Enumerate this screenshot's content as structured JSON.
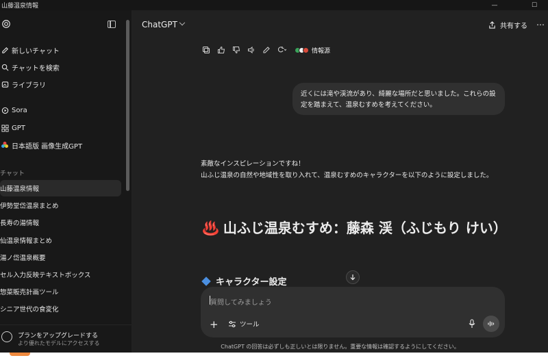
{
  "window": {
    "title": "山藤温泉情報"
  },
  "sidebar": {
    "nav": [
      {
        "label": "新しいチャット",
        "icon": "new-chat-icon"
      },
      {
        "label": "チャットを検索",
        "icon": "search-icon"
      },
      {
        "label": "ライブラリ",
        "icon": "library-icon"
      },
      {
        "label": "Sora",
        "icon": "sora-icon"
      },
      {
        "label": "GPT",
        "icon": "gpt-icon"
      },
      {
        "label": "日本語版 画像生成GPT",
        "icon": "colorful-gpt-icon"
      }
    ],
    "section_label": "チャット",
    "chats": [
      "山藤温泉情報",
      "伊勢堂岱温泉まとめ",
      "長寿の湯情報",
      "仙温泉情報まとめ",
      "湯ノ岱温泉概要",
      "セル入力反映テキストボックス",
      "惣菜販売計画ツール",
      "シニア世代の食変化"
    ],
    "upgrade": {
      "title": "プランをアップグレードする",
      "subtitle": "より優れたモデルにアクセスする"
    }
  },
  "header": {
    "model": "ChatGPT",
    "share_label": "共有する"
  },
  "message_actions": {
    "sources_label": "情報源"
  },
  "user_message": {
    "line1": "近くには滝や渓流があり、綺麗な場所だと思いました。これらの設",
    "line2": "定を踏まえて、温泉むすめを考えてください。"
  },
  "assistant": {
    "line1": "素敵なインスピレーションですね！",
    "line2": "山ふじ温泉の自然や地域性を取り入れて、温泉むすめのキャラクターを以下のように設定しました。",
    "heading_emoji": "♨️",
    "heading": "山ふじ温泉むすめ：藤森 渓（ふじもり けい）",
    "subheading": "キャラクター設定"
  },
  "composer": {
    "placeholder": "質問してみましょう",
    "tools_label": "ツール"
  },
  "disclaimer": "ChatGPT の回答は必ずしも正しいとは限りません。重要な情報は確認するようにしてください。",
  "colors": {
    "sidebar_bg": "#181818",
    "main_bg": "#212121",
    "bubble_bg": "#303030",
    "accent_blue": "#4b8fe0"
  }
}
